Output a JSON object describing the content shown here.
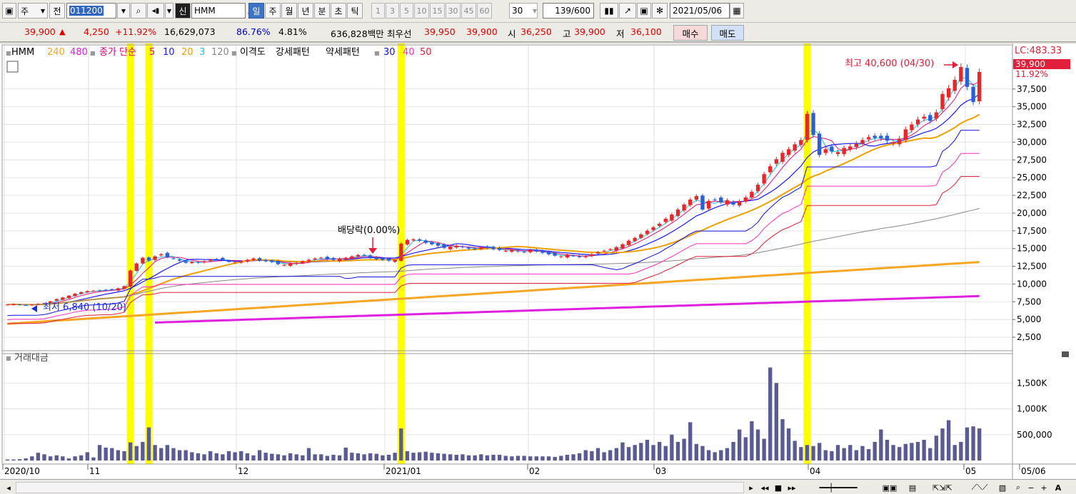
{
  "toolbar": {
    "market_tab": "주",
    "prev_label": "전",
    "code": "011200",
    "new_badge": "신",
    "stock_name": "HMM",
    "periods": [
      "일",
      "주",
      "월",
      "년",
      "분",
      "초",
      "틱"
    ],
    "selected_period": "일",
    "numbers": [
      "1",
      "3",
      "5",
      "10",
      "15",
      "30",
      "45",
      "60"
    ],
    "count_value": "30",
    "bars_count": "139",
    "bars_max": "/600",
    "date": "2021/05/06"
  },
  "quote": {
    "price": "39,900",
    "up_arrow": "▲",
    "change": "4,250",
    "change_pct": "+11.92%",
    "volume": "16,629,073",
    "vol_ratio": "86.76%",
    "turnover": "4.81%",
    "amount": "636,828백만",
    "best_label": "최우선",
    "ask": "39,950",
    "bid": "39,900",
    "open_label": "시",
    "open": "36,250",
    "high_label": "고",
    "high": "39,900",
    "low_label": "저",
    "low": "36,100",
    "buy_label": "매수",
    "sell_label": "매도"
  },
  "price_legend": {
    "name": "HMM",
    "ma_long": [
      "240",
      "480"
    ],
    "close_simple_label": "종가 단순",
    "ma_short": [
      "5",
      "10",
      "20",
      "3",
      "120"
    ],
    "disparity_label": "이격도",
    "strong_label": "강세패턴",
    "weak_label": "약세패턴",
    "patterns": [
      "30",
      "40",
      "50"
    ],
    "colors": {
      "ma240": "#f5a623",
      "ma480": "#e020e0",
      "ma5": "#e0107a",
      "ma10": "#1a1aff",
      "ma20": "#f0a000",
      "ma3": "#20c0e0",
      "ma120": "#888888",
      "up": "#e8272a",
      "down": "#2860d8",
      "highlight": "#ffff00"
    }
  },
  "annotations": {
    "high": "최고 40,600 (04/30)",
    "low": "최저 6,840 (10/20)",
    "dividend": "배당락(0.00%)"
  },
  "right_axis": {
    "lc": "LC:483.33",
    "price_tag": "39,900",
    "pct_tag": "11.92%"
  },
  "volume_legend": "거래대금",
  "x_labels": [
    "2020/10",
    "11",
    "12",
    "2021/01",
    "02",
    "03",
    "04",
    "05",
    "05/06"
  ],
  "chart_data": {
    "type": "candlestick",
    "title": "HMM",
    "price_axis_ticks": [
      2500,
      5000,
      7500,
      10000,
      12500,
      15000,
      17500,
      20000,
      22500,
      25000,
      27500,
      30000,
      32500,
      35000,
      37500
    ],
    "price_axis_tick_labels": [
      "2,500",
      "5,000",
      "7,500",
      "10,000",
      "12,500",
      "15,000",
      "17,500",
      "20,000",
      "22,500",
      "25,000",
      "27,500",
      "30,000",
      "32,500",
      "35,000",
      "37,500"
    ],
    "ylim": [
      1000,
      41500
    ],
    "volume_axis_ticks": [
      500000,
      1000000,
      1500000
    ],
    "volume_axis_tick_labels": [
      "500,000",
      "1,000K",
      "1,500K"
    ],
    "volume_ylim": [
      0,
      2000000
    ],
    "highlight_bars": [
      20,
      23,
      64,
      130
    ],
    "close": [
      7100,
      7180,
      7050,
      7020,
      7100,
      7200,
      7300,
      7550,
      7880,
      8100,
      8350,
      8650,
      8850,
      9000,
      9050,
      9100,
      9150,
      9200,
      9400,
      9700,
      11900,
      12900,
      13700,
      13300,
      13900,
      14200,
      13800,
      13600,
      13300,
      13000,
      13100,
      13000,
      13200,
      13400,
      13500,
      13400,
      13200,
      13100,
      13200,
      13400,
      13600,
      13300,
      13200,
      13100,
      12800,
      12700,
      12900,
      13000,
      13200,
      13400,
      13600,
      13700,
      13500,
      13400,
      13600,
      13700,
      13900,
      14100,
      14000,
      13700,
      13500,
      13400,
      13300,
      13400,
      15700,
      16200,
      16300,
      16100,
      15800,
      15600,
      15400,
      15100,
      15300,
      15400,
      15200,
      15000,
      14900,
      15200,
      15100,
      14900,
      14800,
      14700,
      14800,
      14600,
      14500,
      14800,
      14600,
      14400,
      14200,
      14000,
      13900,
      14100,
      14000,
      13800,
      13900,
      14200,
      14500,
      14700,
      14900,
      15200,
      15600,
      16100,
      16500,
      17000,
      17500,
      18000,
      18500,
      19200,
      19800,
      20500,
      21200,
      21900,
      22400,
      20500,
      21700,
      21900,
      21500,
      21800,
      21200,
      21700,
      22200,
      23000,
      24000,
      25500,
      26600,
      27600,
      28500,
      29000,
      29700,
      30300,
      34000,
      31000,
      28200,
      29000,
      28700,
      28600,
      29200,
      29400,
      29800,
      30300,
      30700,
      30600,
      30500,
      30200,
      30000,
      30500,
      31800,
      32500,
      33200,
      33600,
      33000,
      34200,
      36800,
      37600,
      38800,
      40600,
      37800,
      35650,
      39900
    ],
    "volume": [
      20000,
      20000,
      25000,
      40000,
      80000,
      150000,
      120000,
      80000,
      100000,
      80000,
      40000,
      80000,
      100000,
      160000,
      60000,
      300000,
      250000,
      240000,
      200000,
      180000,
      350000,
      280000,
      360000,
      640000,
      300000,
      240000,
      300000,
      240000,
      200000,
      200000,
      160000,
      140000,
      120000,
      180000,
      140000,
      120000,
      180000,
      160000,
      180000,
      140000,
      100000,
      200000,
      150000,
      130000,
      120000,
      100000,
      140000,
      120000,
      100000,
      240000,
      120000,
      120000,
      90000,
      110000,
      100000,
      250000,
      150000,
      140000,
      120000,
      140000,
      130000,
      100000,
      110000,
      150000,
      620000,
      180000,
      150000,
      160000,
      170000,
      150000,
      140000,
      130000,
      120000,
      110000,
      120000,
      100000,
      100000,
      120000,
      100000,
      110000,
      110000,
      90000,
      80000,
      90000,
      90000,
      80000,
      80000,
      80000,
      80000,
      70000,
      90000,
      110000,
      120000,
      140000,
      200000,
      180000,
      240000,
      160000,
      200000,
      240000,
      350000,
      260000,
      300000,
      340000,
      400000,
      300000,
      360000,
      280000,
      500000,
      360000,
      420000,
      740000,
      320000,
      280000,
      200000,
      160000,
      200000,
      240000,
      360000,
      600000,
      450000,
      760000,
      600000,
      420000,
      1800000,
      1500000,
      800000,
      620000,
      380000,
      260000,
      300000,
      280000,
      340000,
      200000,
      180000,
      300000,
      240000,
      300000,
      200000,
      280000,
      220000,
      360000,
      600000,
      400000,
      300000,
      260000,
      320000,
      340000,
      360000,
      400000,
      240000,
      480000,
      620000,
      780000,
      300000,
      360000,
      640000,
      660000,
      620000
    ]
  }
}
